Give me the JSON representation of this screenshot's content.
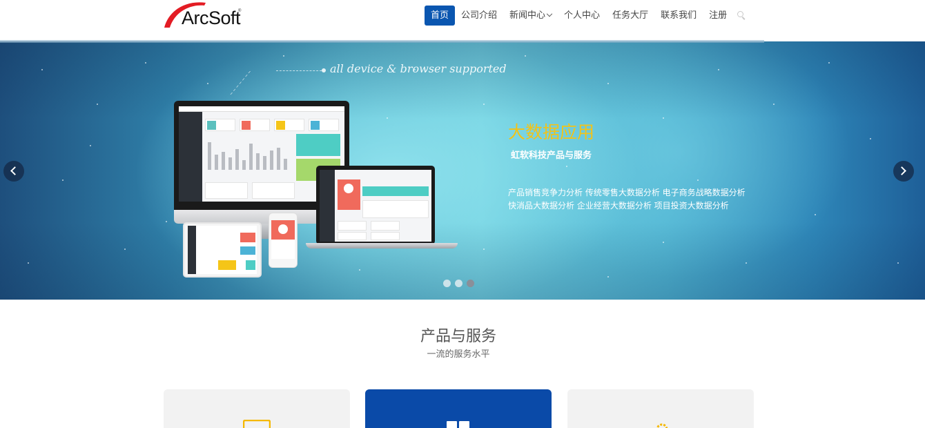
{
  "brand": {
    "logo_text": "ArcSoft",
    "logo_mark": "®",
    "accent_color": "#0a56b0",
    "logo_color": "#e31c24"
  },
  "nav": {
    "items": [
      {
        "label": "首页",
        "active": true
      },
      {
        "label": "公司介绍",
        "active": false
      },
      {
        "label": "新闻中心",
        "active": false,
        "dropdown": true
      },
      {
        "label": "个人中心",
        "active": false
      },
      {
        "label": "任务大厅",
        "active": false
      },
      {
        "label": "联系我们",
        "active": false
      },
      {
        "label": "注册",
        "active": false
      }
    ],
    "search_icon": "search-icon"
  },
  "hero": {
    "tagline": "all device & browser supported",
    "title": "大数据应用",
    "subtitle": "虹软科技产品与服务",
    "line1": "产品销售竞争力分析 传统零售大数据分析 电子商务战略数据分析",
    "line2": "快消品大数据分析 企业经营大数据分析 项目投资大数据分析",
    "title_color": "#f2c318",
    "slides": 3,
    "active_slide": 3,
    "prev_icon": "chevron-left-icon",
    "next_icon": "chevron-right-icon"
  },
  "services": {
    "title": "产品与服务",
    "subtitle": "一流的服务水平",
    "cards": [
      {
        "icon": "monitor-icon",
        "featured": false,
        "icon_color": "#f5b800"
      },
      {
        "icon": "grid-icon",
        "featured": true,
        "icon_color": "#ffffff"
      },
      {
        "icon": "gear-icon",
        "featured": false,
        "icon_color": "#f5b800"
      }
    ]
  }
}
